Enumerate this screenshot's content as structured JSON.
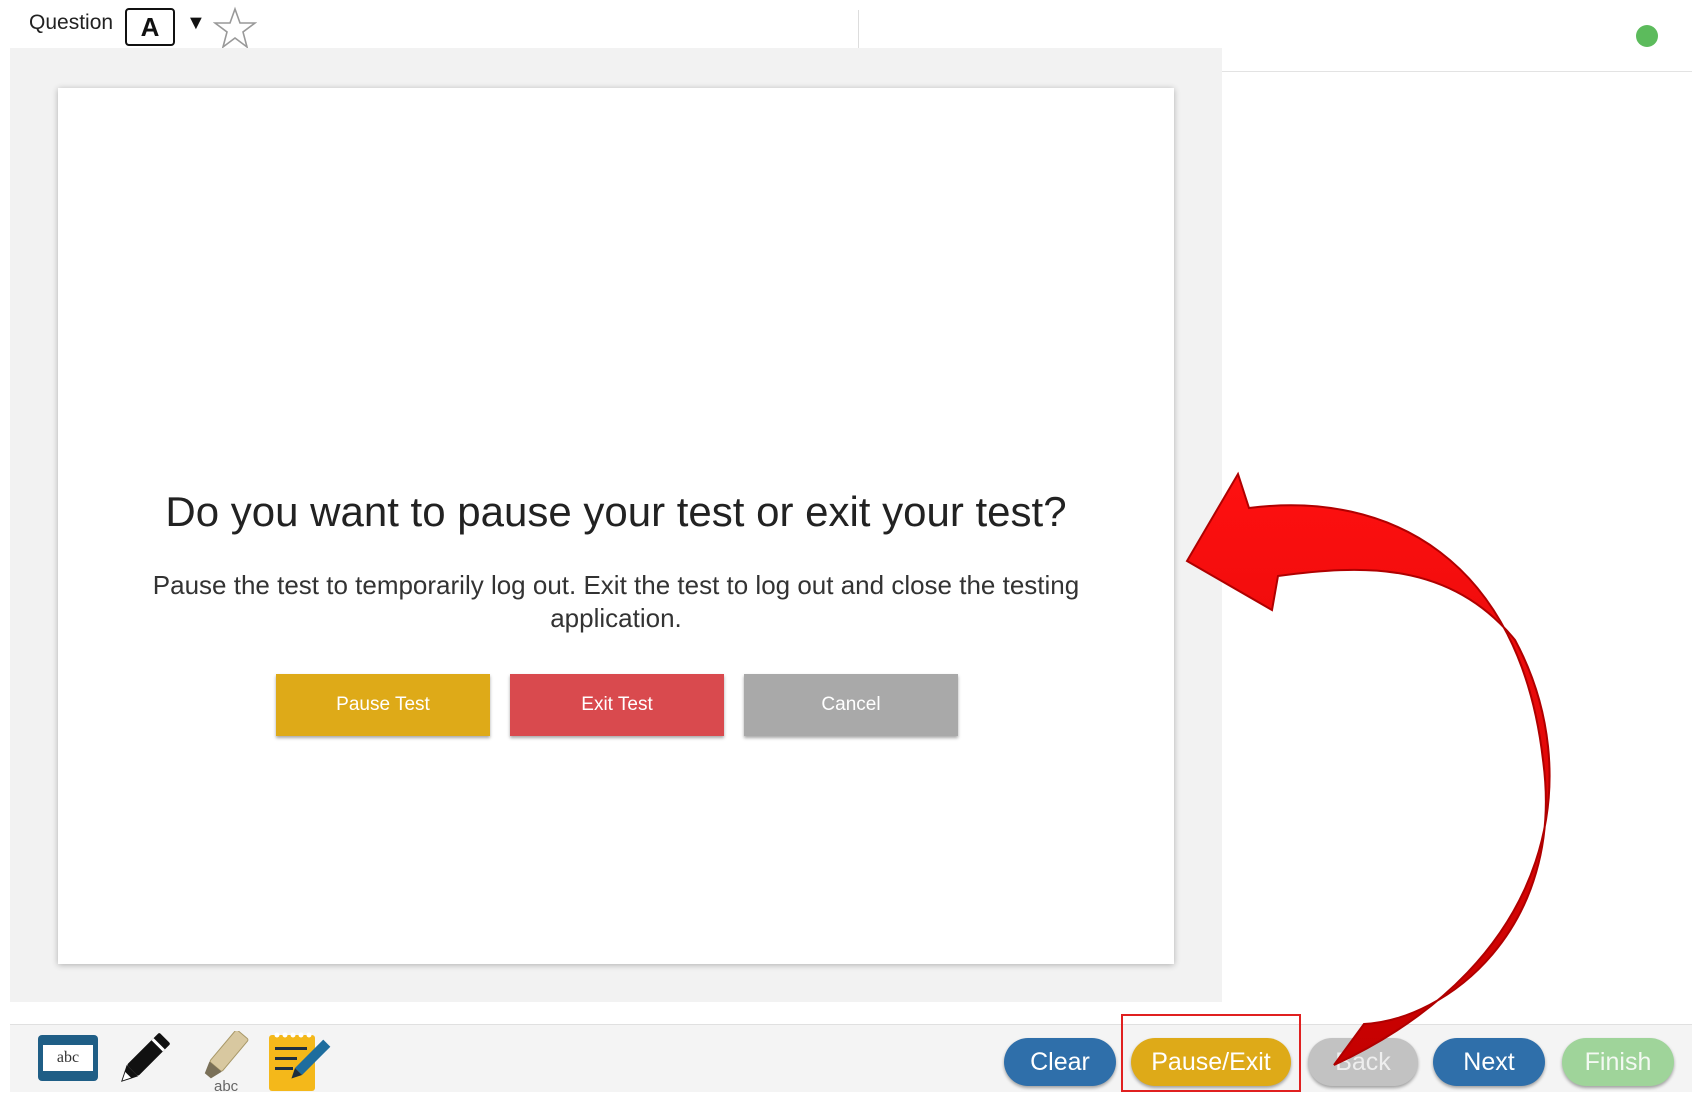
{
  "header": {
    "question_label": "Question",
    "question_id": "A",
    "dropdown_glyph": "▼",
    "bookmark_icon": "star-outline-icon",
    "status_color": "#5cbb5c"
  },
  "dialog": {
    "title": "Do you want to pause your test or exit your test?",
    "message": "Pause the test to temporarily log out. Exit the test to log out and close the testing application.",
    "buttons": {
      "pause": "Pause Test",
      "exit": "Exit Test",
      "cancel": "Cancel"
    }
  },
  "footer": {
    "tools": {
      "dictionary_label": "abc",
      "highlighter_label": "abc",
      "icons": [
        "dictionary-icon",
        "pencil-icon",
        "highlighter-icon",
        "notepad-icon"
      ]
    },
    "nav": {
      "clear": "Clear",
      "pause_exit": "Pause/Exit",
      "back": "Back",
      "next": "Next",
      "finish": "Finish"
    }
  },
  "colors": {
    "blue": "#2f6faa",
    "yellow": "#deaa18",
    "red": "#d94a4e",
    "gray": "#a9a9a9",
    "green": "#9fd49a",
    "annotation_red": "#e60000"
  }
}
